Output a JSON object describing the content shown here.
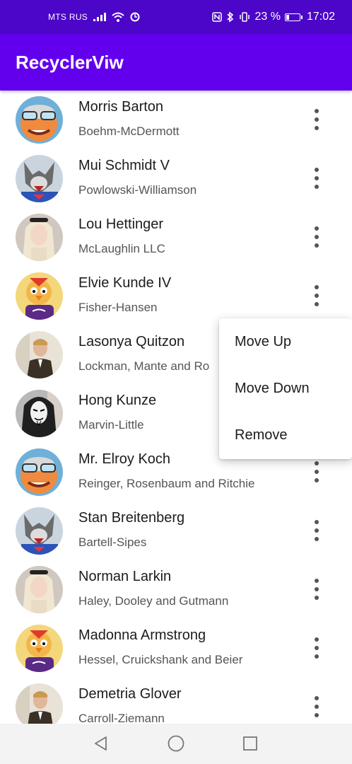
{
  "status_bar": {
    "carrier": "MTS RUS",
    "battery_text": "23 %",
    "battery_level": 0.23,
    "time": "17:02",
    "icons_left": [
      "signal-icon",
      "wifi-icon",
      "sync-icon"
    ],
    "icons_right": [
      "nfc-icon",
      "bluetooth-icon",
      "vibrate-icon",
      "battery-icon"
    ]
  },
  "app_bar": {
    "title": "RecyclerViw"
  },
  "contacts": [
    {
      "name": "Morris Barton",
      "company": "Boehm-McDermott",
      "avatar": "avatar-cartoon-glasses"
    },
    {
      "name": "Mui Schmidt V",
      "company": "Powlowski-Williamson",
      "avatar": "avatar-wolf-hero"
    },
    {
      "name": "Lou Hettinger",
      "company": "McLaughlin LLC",
      "avatar": "avatar-blonde-woman"
    },
    {
      "name": "Elvie Kunde IV",
      "company": "Fisher-Hansen",
      "avatar": "avatar-cartoon-bird"
    },
    {
      "name": "Lasonya Quitzon",
      "company": "Lockman, Mante and Ro",
      "avatar": "avatar-man-suit"
    },
    {
      "name": "Hong Kunze",
      "company": "Marvin-Little",
      "avatar": "avatar-masked-hood"
    },
    {
      "name": "Mr. Elroy Koch",
      "company": "Reinger, Rosenbaum and Ritchie",
      "avatar": "avatar-cartoon-glasses"
    },
    {
      "name": "Stan Breitenberg",
      "company": "Bartell-Sipes",
      "avatar": "avatar-wolf-hero"
    },
    {
      "name": "Norman Larkin",
      "company": "Haley, Dooley and Gutmann",
      "avatar": "avatar-blonde-woman"
    },
    {
      "name": "Madonna Armstrong",
      "company": "Hessel, Cruickshank and Beier",
      "avatar": "avatar-cartoon-bird"
    },
    {
      "name": "Demetria Glover",
      "company": "Carroll-Ziemann",
      "avatar": "avatar-man-suit"
    }
  ],
  "popup_menu": {
    "items": [
      "Move Up",
      "Move Down",
      "Remove"
    ]
  },
  "nav_bar": {
    "buttons": [
      "back-icon",
      "home-icon",
      "recents-icon"
    ]
  },
  "colors": {
    "status_bar": "#4b06c8",
    "app_bar": "#6200ee",
    "background": "#ffffff",
    "text_primary": "#1c1c1c",
    "text_secondary": "#555555"
  }
}
